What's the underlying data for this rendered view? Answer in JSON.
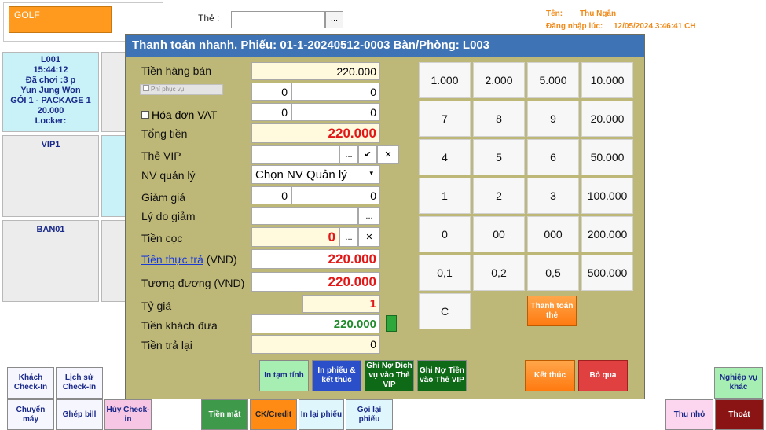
{
  "top": {
    "golf_label": "GOLF",
    "the_label": "Thẻ :",
    "the_btn": "...",
    "ten_label": "Tên:",
    "ten_value": "Thu Ngân",
    "login_label": "Đăng nhập lúc:",
    "login_value": "12/05/2024 3:46:41 CH"
  },
  "rooms": {
    "l001": [
      "L001",
      "15:44:12",
      "Đã chơi :3 p",
      "Yun Jung Won",
      "GÓI 1 - PACKAGE 1",
      "20.000",
      "Locker:"
    ],
    "vip1": "VIP1",
    "ban01": "BAN01"
  },
  "dialog": {
    "title": "Thanh toán nhanh. Phiếu: 01-1-20240512-0003 Bàn/Phòng: L003",
    "tien_hang_ban": {
      "label": "Tiền hàng bán",
      "value": "220.000"
    },
    "phi_phuc_vu": {
      "label": "Phí phục vụ",
      "v1": "0",
      "v2": "0"
    },
    "hoa_don_vat": {
      "label": "Hóa đơn VAT",
      "v1": "0",
      "v2": "0"
    },
    "tong_tien": {
      "label": "Tổng tiền",
      "value": "220.000"
    },
    "the_vip": {
      "label": "Thẻ VIP",
      "btn_more": "...",
      "btn_ok": "✔",
      "btn_clear": "✕"
    },
    "nv_quan_ly": {
      "label": "NV quản lý",
      "value": "Chọn NV Quản lý"
    },
    "giam_gia": {
      "label": "Giảm giá",
      "v1": "0",
      "v2": "0"
    },
    "ly_do_giam": {
      "label": "Lý do giảm",
      "btn_more": "..."
    },
    "tien_coc": {
      "label": "Tiền cọc",
      "value": "0",
      "btn_more": "...",
      "btn_clear": "✕"
    },
    "tien_thuc_tra": {
      "link": "Tiền thực trả",
      "unit": "(VND)",
      "value": "220.000"
    },
    "tuong_duong": {
      "label": "Tương đương",
      "unit": "(VND)",
      "value": "220.000"
    },
    "ty_gia": {
      "label": "Tỷ giá",
      "value": "1"
    },
    "tien_khach_dua": {
      "label": "Tiền khách đưa",
      "value": "220.000"
    },
    "tien_tra_lai": {
      "label": "Tiền trả lại",
      "value": "0"
    },
    "keypad": [
      [
        "1.000",
        "2.000",
        "5.000",
        "10.000"
      ],
      [
        "7",
        "8",
        "9",
        "20.000"
      ],
      [
        "4",
        "5",
        "6",
        "50.000"
      ],
      [
        "1",
        "2",
        "3",
        "100.000"
      ],
      [
        "0",
        "00",
        "000",
        "200.000"
      ],
      [
        "0,1",
        "0,2",
        "0,5",
        "500.000"
      ]
    ],
    "key_c": "C",
    "btn_thanh_toan_the": "Thanh toán thẻ",
    "btn_in_tam_tinh": "In tạm tính",
    "btn_in_phieu_ket_thuc": "In phiếu & kết thúc",
    "btn_ghi_no_dich_vu": "Ghi Nợ Dịch vụ vào Thẻ VIP",
    "btn_ghi_no_tien": "Ghi Nợ Tiền vào Thẻ VIP",
    "btn_ket_thuc": "Kết thúc",
    "btn_bo_qua": "Bỏ qua"
  },
  "bottom": {
    "khach_checkin": "Khách Check-In",
    "lich_su_checkin": "Lịch sử Check-In",
    "chuyen_may": "Chuyển máy",
    "ghep_bill": "Ghép bill",
    "huy_checkin": "Hủy Check-in",
    "tien_mat": "Tiền mặt",
    "ck_credit": "CK/Credit",
    "in_lai_phieu": "In lại phiếu",
    "goi_lai_phieu": "Gọi lại phiếu",
    "nghiep_vu_khac": "Nghiệp vụ khác",
    "thu_nho": "Thu nhỏ",
    "thoat": "Thoát"
  }
}
